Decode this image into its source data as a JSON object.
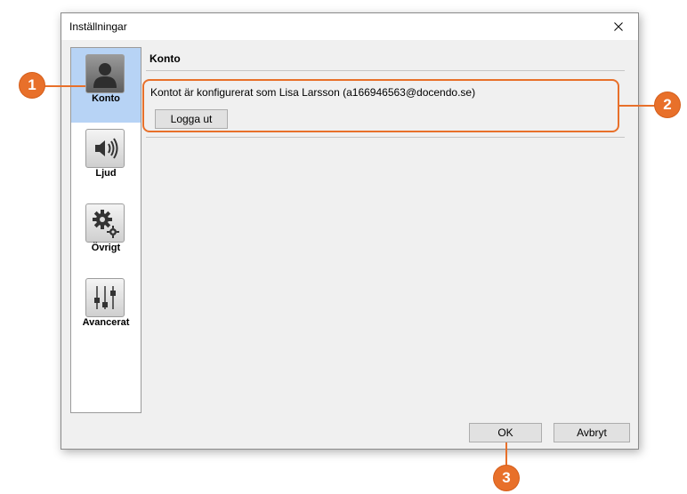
{
  "window": {
    "title": "Inställningar"
  },
  "sidebar": {
    "items": [
      {
        "label": "Konto",
        "icon": "user-icon"
      },
      {
        "label": "Ljud",
        "icon": "speaker-icon"
      },
      {
        "label": "Övrigt",
        "icon": "gears-icon"
      },
      {
        "label": "Avancerat",
        "icon": "sliders-icon"
      }
    ]
  },
  "content": {
    "section_title": "Konto",
    "account_text": "Kontot är konfigurerat som Lisa Larsson (a166946563@docendo.se)",
    "logout_label": "Logga ut"
  },
  "footer": {
    "ok_label": "OK",
    "cancel_label": "Avbryt"
  },
  "callouts": [
    "1",
    "2",
    "3"
  ],
  "colors": {
    "accent": "#e8702a",
    "selected": "#b7d3f5"
  }
}
